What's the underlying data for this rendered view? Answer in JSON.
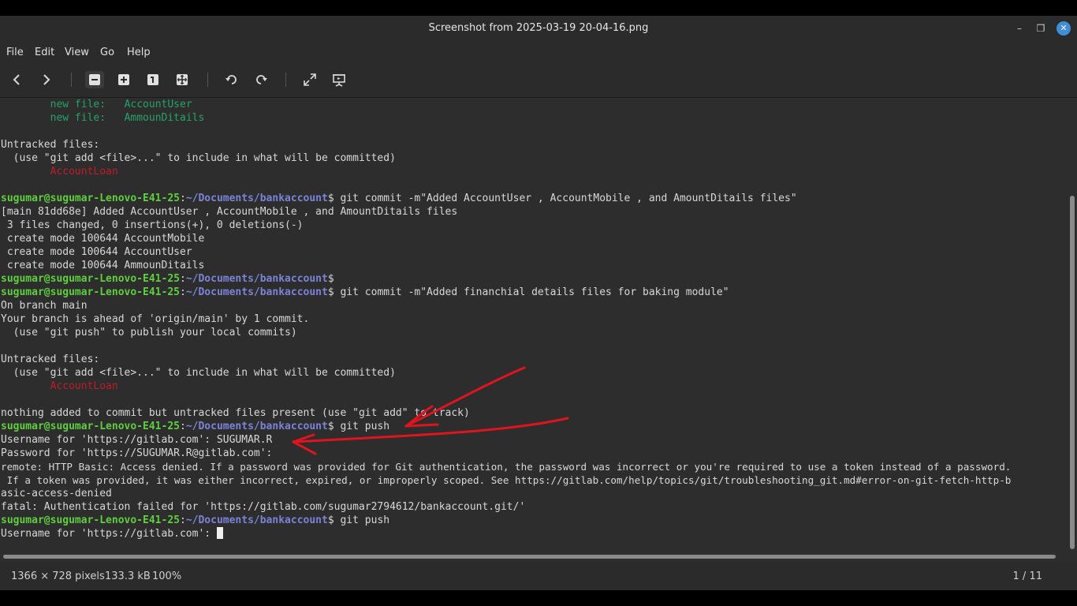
{
  "window": {
    "title": "Screenshot from 2025-03-19 20-04-16.png",
    "min_glyph": "–",
    "max_glyph": "❐",
    "close_glyph": "✕"
  },
  "menu": [
    "File",
    "Edit",
    "View",
    "Go",
    "Help"
  ],
  "terminal": {
    "prompt_user": "sugumar@sugumar-Lenovo-E41-25",
    "prompt_path": "~/Documents/bankaccount",
    "lines": {
      "l0_label": "new file:",
      "l0_value": "AccountUser",
      "l1_label": "new file:",
      "l1_value": "AmmounDitails",
      "l3": "Untracked files:",
      "l4": "  (use \"git add <file>...\" to include in what will be committed)",
      "l5": "AccountLoan",
      "l7_cmd": "$ git commit -m\"Added AccountUser , AccountMobile , and AmountDitails files\"",
      "l8": "[main 81dd68e] Added AccountUser , AccountMobile , and AmountDitails files",
      "l9": " 3 files changed, 0 insertions(+), 0 deletions(-)",
      "l10": " create mode 100644 AccountMobile",
      "l11": " create mode 100644 AccountUser",
      "l12": " create mode 100644 AmmounDitails",
      "l13_cmd": "$",
      "l14_cmd": "$ git commit -m\"Added financhial details files for baking module\"",
      "l15": "On branch main",
      "l16": "Your branch is ahead of 'origin/main' by 1 commit.",
      "l17": "  (use \"git push\" to publish your local commits)",
      "l19": "Untracked files:",
      "l20": "  (use \"git add <file>...\" to include in what will be committed)",
      "l21": "AccountLoan",
      "l23": "nothing added to commit but untracked files present (use \"git add\" to track)",
      "l24_cmd": "$ git push",
      "l25": "Username for 'https://gitlab.com': SUGUMAR.R",
      "l26": "Password for 'https://SUGUMAR.R@gitlab.com':",
      "l27": "remote: HTTP Basic: Access denied. If a password was provided for Git authentication, the password was incorrect or you're required to use a token instead of a password.",
      "l28": " If a token was provided, it was either incorrect, expired, or improperly scoped. See https://gitlab.com/help/topics/git/troubleshooting_git.md#error-on-git-fetch-http-b",
      "l29": "asic-access-denied",
      "l30": "fatal: Authentication failed for 'https://gitlab.com/sugumar2794612/bankaccount.git/'",
      "l31_cmd": "$ git push",
      "l32": "Username for 'https://gitlab.com': "
    }
  },
  "status": {
    "dimensions": "1366 × 728 pixels",
    "size": "133.3 kB",
    "zoom": "100%",
    "page": "1 / 11"
  },
  "colors": {
    "annotation": "#e0141e",
    "staged_file": "#26a269",
    "untracked_file": "#c01c28",
    "prompt_user": "#5fcf3d",
    "prompt_path": "#7b83d6"
  }
}
